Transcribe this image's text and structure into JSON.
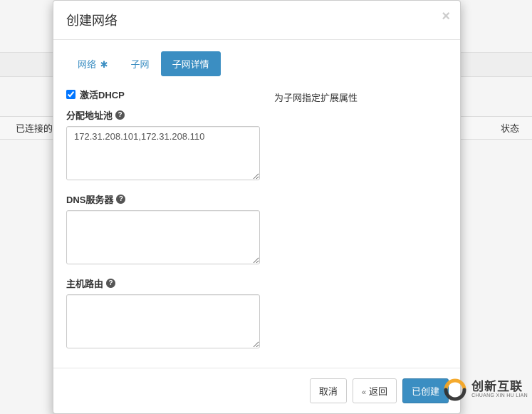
{
  "bg": {
    "col1": "已连接的",
    "col2": "状态"
  },
  "modal": {
    "title": "创建网络",
    "tabs": [
      {
        "label": "网络",
        "required": true
      },
      {
        "label": "子网",
        "required": false
      },
      {
        "label": "子网详情",
        "required": false
      }
    ],
    "active_tab_index": 2,
    "help_text": "为子网指定扩展属性",
    "dhcp": {
      "label": "激活DHCP",
      "checked": true
    },
    "fields": {
      "pool": {
        "label": "分配地址池",
        "value": "172.31.208.101,172.31.208.110"
      },
      "dns": {
        "label": "DNS服务器",
        "value": ""
      },
      "routes": {
        "label": "主机路由",
        "value": ""
      }
    },
    "footer": {
      "cancel": "取消",
      "back": "返回",
      "back_prefix": "«",
      "submit": "已创建"
    }
  },
  "brand": {
    "cn": "创新互联",
    "en": "CHUANG XIN HU LIAN"
  },
  "colors": {
    "primary": "#3b8ec2"
  }
}
